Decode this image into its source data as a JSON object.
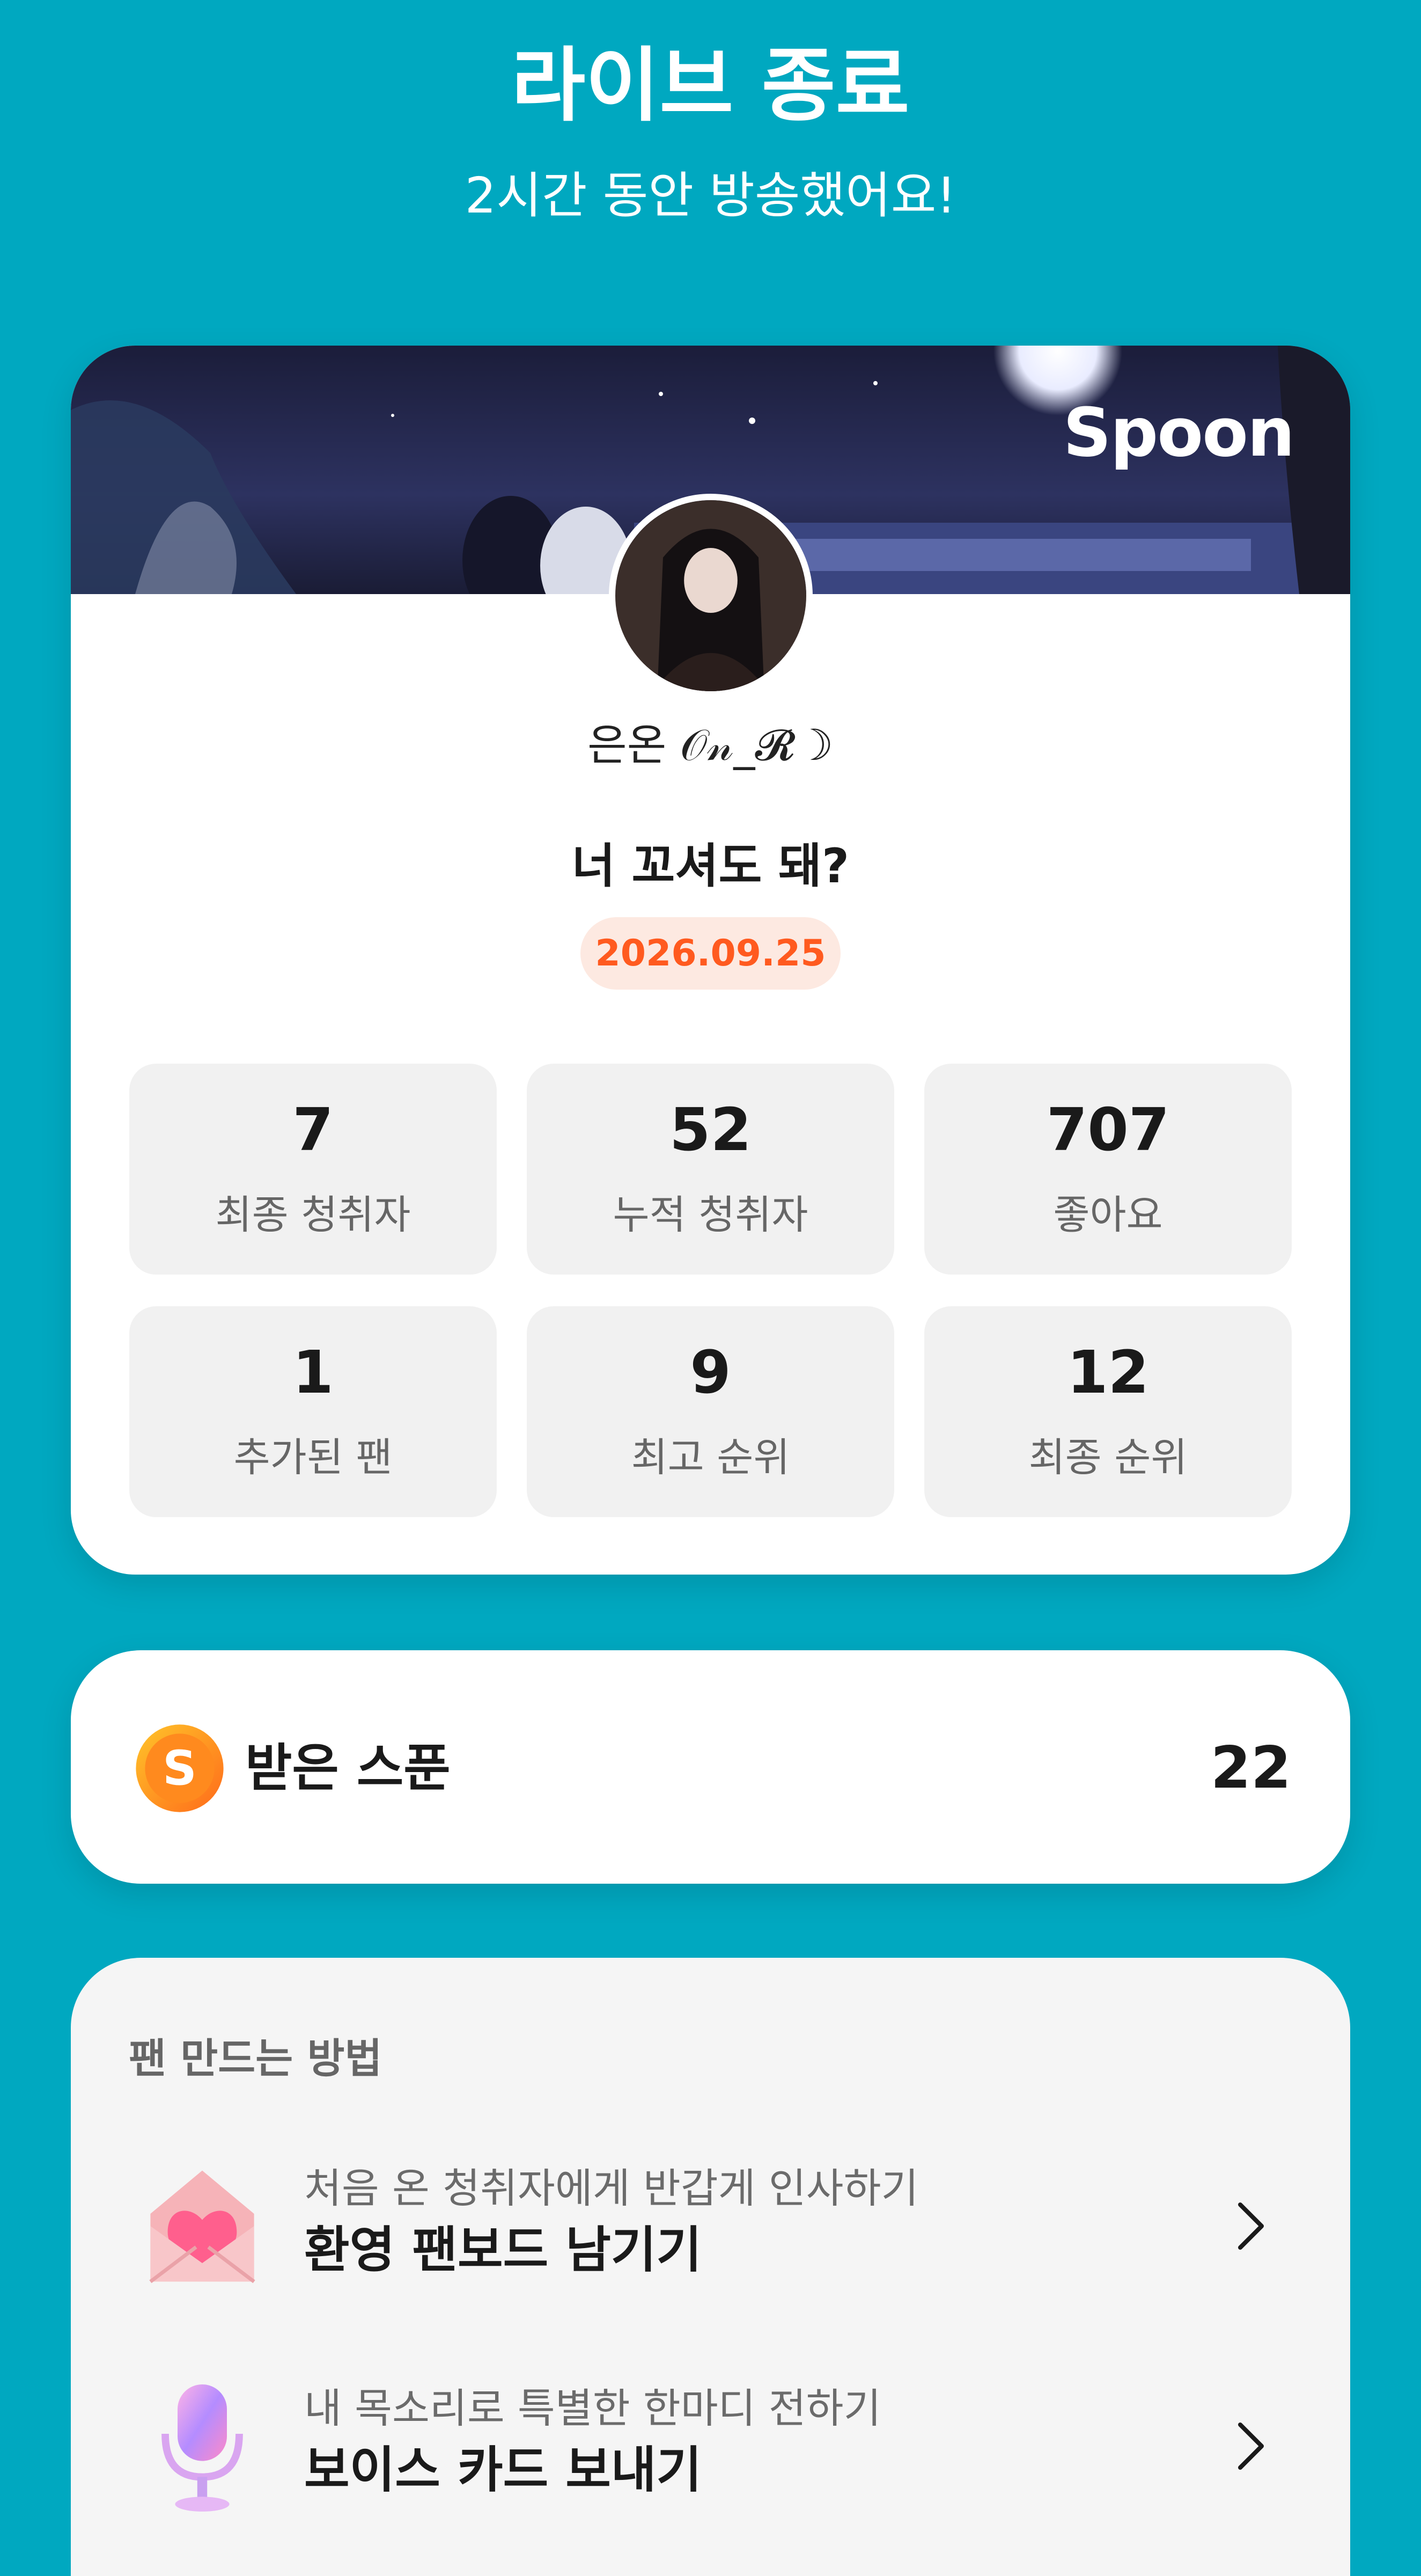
{
  "header": {
    "title": "라이브 종료",
    "subtitle": "2시간 동안 방송했어요!"
  },
  "summary": {
    "brand": "Spoon",
    "username": "은온 𝒪𝓃_𝓡☽",
    "live_title": "너 꼬셔도 돼?",
    "date": "2026.09.25",
    "stats": [
      {
        "value": "7",
        "label": "최종 청취자"
      },
      {
        "value": "52",
        "label": "누적 청취자"
      },
      {
        "value": "707",
        "label": "좋아요"
      },
      {
        "value": "1",
        "label": "추가된 팬"
      },
      {
        "value": "9",
        "label": "최고 순위"
      },
      {
        "value": "12",
        "label": "최종 순위"
      }
    ]
  },
  "spoon": {
    "icon": "spoon-coin-icon",
    "label": "받은 스푼",
    "count": "22"
  },
  "fan_guide": {
    "heading": "팬 만드는 방법",
    "items": [
      {
        "icon": "heart-envelope-icon",
        "desc": "처음 온 청취자에게 반갑게 인사하기",
        "title": "환영 팬보드 남기기"
      },
      {
        "icon": "microphone-icon",
        "desc": "내 목소리로 특별한 한마디 전하기",
        "title": "보이스 카드 보내기"
      }
    ]
  },
  "colors": {
    "background": "#00a8c0",
    "date_badge_text": "#ff5a1f",
    "date_badge_bg": "#fde9e1"
  }
}
